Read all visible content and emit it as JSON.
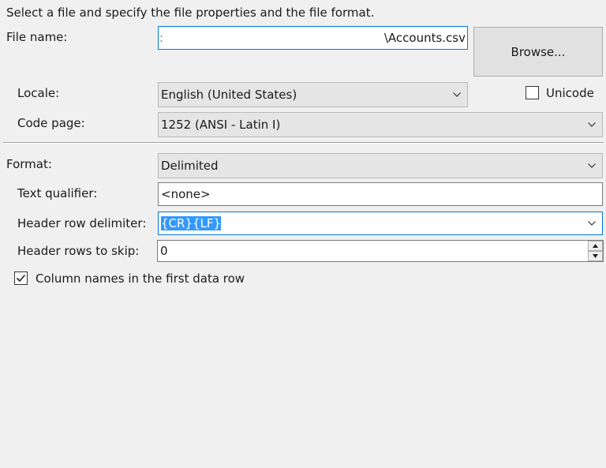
{
  "instructions": "Select a file and specify the file properties and the file format.",
  "file_name": {
    "label": "File name:",
    "value_prefix": ":",
    "value_suffix": "‎\\Accounts.csv"
  },
  "browse_button": "Browse...",
  "locale": {
    "label": "Locale:",
    "value": "English (United States)"
  },
  "unicode": {
    "label": "Unicode",
    "checked": false
  },
  "code_page": {
    "label": "Code page:",
    "value": "1252  (ANSI - Latin I)"
  },
  "format": {
    "label": "Format:",
    "value": "Delimited"
  },
  "text_qualifier": {
    "label": "Text qualifier:",
    "value": "<none>"
  },
  "header_row_delimiter": {
    "label": "Header row delimiter:",
    "value": "{CR}{LF}"
  },
  "header_rows_to_skip": {
    "label": "Header rows to skip:",
    "value": "0"
  },
  "column_names": {
    "label": "Column names in the first data row",
    "checked": true
  },
  "colors": {
    "focus_border": "#0078d7",
    "selection": "#3399ff",
    "background": "#f0f0f0"
  }
}
